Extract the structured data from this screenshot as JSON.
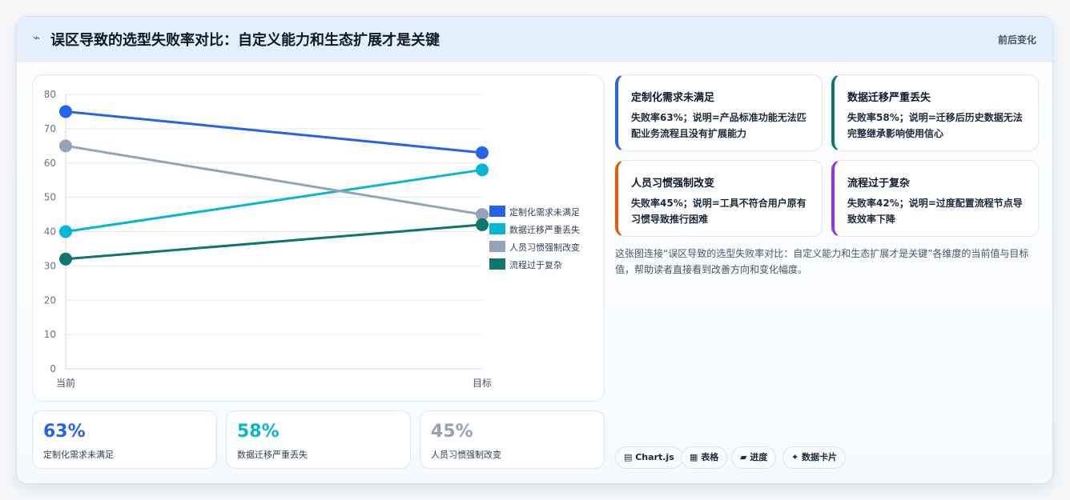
{
  "header": {
    "icon": "bolt-icon",
    "title": "误区导致的选型失败率对比：自定义能力和生态扩展才是关键",
    "right_label": "前后变化"
  },
  "chart_data": {
    "type": "line",
    "title": "",
    "xlabel": "",
    "ylabel": "",
    "x": [
      "当前",
      "目标"
    ],
    "ylim": [
      0,
      80
    ],
    "yticks": [
      0,
      10,
      20,
      30,
      40,
      50,
      60,
      70,
      80
    ],
    "grid": true,
    "legend_position": "right",
    "series": [
      {
        "name": "定制化需求未满足",
        "values": [
          75,
          63
        ],
        "color": "#2563eb"
      },
      {
        "name": "数据迁移严重丢失",
        "values": [
          40,
          58
        ],
        "color": "#06b6d4"
      },
      {
        "name": "人员习惯强制改变",
        "values": [
          65,
          45
        ],
        "color": "#94a3b8"
      },
      {
        "name": "流程过于复杂",
        "values": [
          32,
          42
        ],
        "color": "#0f766e"
      }
    ]
  },
  "stats": [
    {
      "value": "63%",
      "label": "定制化需求未满足",
      "color": "#2563eb"
    },
    {
      "value": "58%",
      "label": "数据迁移严重丢失",
      "color": "#06b6d4"
    },
    {
      "value": "45%",
      "label": "人员习惯强制改变",
      "color": "#94a3b8"
    }
  ],
  "info_cards": [
    {
      "title": "定制化需求未满足",
      "desc": "失败率63%；说明=产品标准功能无法匹配业务流程且没有扩展能力",
      "accent": "#2563eb"
    },
    {
      "title": "数据迁移严重丢失",
      "desc": "失败率58%；说明=迁移后历史数据无法完整继承影响使用信心",
      "accent": "#0f766e"
    },
    {
      "title": "人员习惯强制改变",
      "desc": "失败率45%；说明=工具不符合用户原有习惯导致推行困难",
      "accent": "#ea580c"
    },
    {
      "title": "流程过于复杂",
      "desc": "失败率42%；说明=过度配置流程节点导致效率下降",
      "accent": "#9333ea"
    }
  ],
  "description": "这张图连接“误区导致的选型失败率对比：自定义能力和生态扩展才是关键”各维度的当前值与目标值，帮助读者直接看到改善方向和变化幅度。",
  "tags": [
    {
      "icon": "chart-icon",
      "label": "Chart.js"
    },
    {
      "icon": "table-icon",
      "label": "表格"
    },
    {
      "icon": "progress-icon",
      "label": "进度"
    },
    {
      "icon": "sparkle-icon",
      "label": "数据卡片"
    }
  ]
}
